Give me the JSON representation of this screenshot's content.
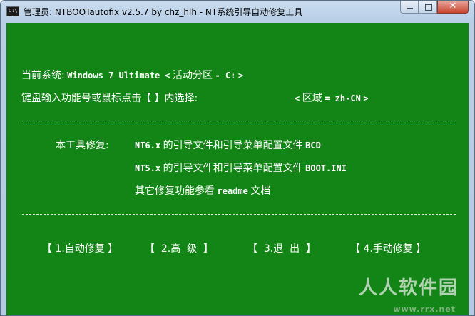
{
  "window": {
    "icon_text": "C:\\",
    "title": "管理员:  NTBOOTautofix v2.5.7 by chz_hlh - NT系统引导自动修复工具",
    "controls": {
      "minimize": "minimize-icon",
      "maximize": "maximize-icon",
      "close": "close-icon"
    }
  },
  "status": {
    "current_system_label": "当前系统:",
    "current_system_value": "Windows 7 Ultimate",
    "partition_open": "<",
    "partition_label": "活动分区",
    "partition_value": "- C:",
    "partition_close": ">",
    "prompt": "键盘输入功能号或鼠标点击【 】内选择:",
    "region_open": "<",
    "region_label": "区域",
    "region_value": "= zh-CN",
    "region_close": ">"
  },
  "repairs": {
    "heading": "本工具修复:",
    "items": [
      {
        "code": "NT6.x",
        "text": "的引导文件和引导菜单配置文件",
        "target": "BCD"
      },
      {
        "code": "NT5.x",
        "text": "的引导文件和引导菜单配置文件",
        "target": "BOOT.INI"
      },
      {
        "pre": "其它修复功能参看",
        "code": "readme",
        "text": "文档"
      }
    ]
  },
  "menu": [
    {
      "label": "【 1.自动修复 】"
    },
    {
      "label": "【  2.高  级  】"
    },
    {
      "label": "【  3.退  出  】"
    },
    {
      "label": "【 4.手动修复 】"
    }
  ],
  "watermark": {
    "text": "人人软件园",
    "url": "www.rrx.net"
  },
  "colors": {
    "console_bg": "#138416",
    "text": "#ffffff"
  }
}
